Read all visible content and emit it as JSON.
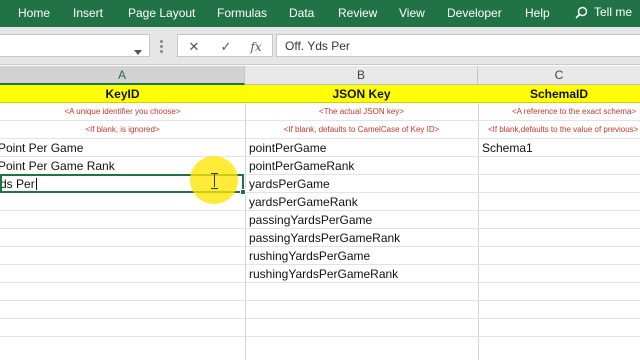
{
  "ribbon": {
    "tabs": [
      "Home",
      "Insert",
      "Page Layout",
      "Formulas",
      "Data",
      "Review",
      "View",
      "Developer",
      "Help"
    ],
    "tell_me": "Tell me",
    "background_color": "#217346"
  },
  "formula_bar": {
    "cancel_icon": "✕",
    "enter_icon": "✓",
    "fx_label": "fx",
    "value": "Off. Yds Per"
  },
  "columns": [
    {
      "letter": "A",
      "header": "KeyID",
      "note1": "<A unique identifier you choose>",
      "note2": "<If blank, is ignored>"
    },
    {
      "letter": "B",
      "header": "JSON Key",
      "note1": "<The actual JSON key>",
      "note2": "<If blank, defaults to CamelCase of Key ID>"
    },
    {
      "letter": "C",
      "header": "SchemaID",
      "note1": "<A reference to the exact schema>",
      "note2": "<If blank,defaults to the value of previous>"
    }
  ],
  "rows": [
    {
      "a": "Point Per Game",
      "b": "pointPerGame",
      "c": "Schema1"
    },
    {
      "a": "Point Per Game Rank",
      "b": "pointPerGameRank",
      "c": ""
    },
    {
      "a": "Yds Per",
      "b": "yardsPerGame",
      "c": ""
    },
    {
      "a": "",
      "b": "yardsPerGameRank",
      "c": ""
    },
    {
      "a": "",
      "b": "passingYardsPerGame",
      "c": ""
    },
    {
      "a": "",
      "b": "passingYardsPerGameRank",
      "c": ""
    },
    {
      "a": "",
      "b": "rushingYardsPerGame",
      "c": ""
    },
    {
      "a": "",
      "b": "rushingYardsPerGameRank",
      "c": ""
    },
    {
      "a": "",
      "b": "",
      "c": ""
    },
    {
      "a": "",
      "b": "",
      "c": ""
    },
    {
      "a": "",
      "b": "",
      "c": ""
    }
  ]
}
